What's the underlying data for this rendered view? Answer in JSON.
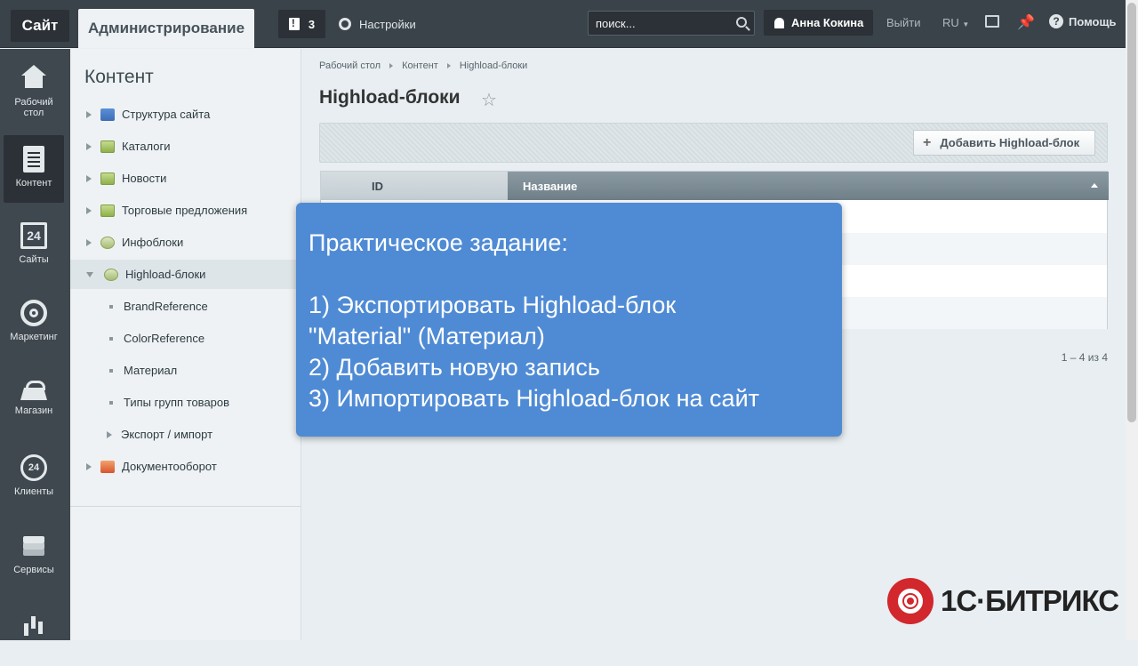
{
  "topbar": {
    "site_label": "Сайт",
    "admin_label": "Администрирование",
    "notifications_count": "3",
    "settings_label": "Настройки",
    "search_placeholder": "поиск...",
    "user_name": "Анна Кокина",
    "logout_label": "Выйти",
    "language_label": "RU",
    "help_label": "Помощь"
  },
  "leftnav": {
    "items": [
      {
        "label": "Рабочий стол",
        "icon": "home-icon"
      },
      {
        "label": "Контент",
        "icon": "document-icon"
      },
      {
        "label": "Сайты",
        "icon": "calendar-24-icon",
        "icon_text": "24"
      },
      {
        "label": "Маркетинг",
        "icon": "target-icon"
      },
      {
        "label": "Магазин",
        "icon": "basket-icon"
      },
      {
        "label": "Клиенты",
        "icon": "clients-24-icon",
        "icon_text": "24"
      },
      {
        "label": "Сервисы",
        "icon": "layers-icon"
      },
      {
        "label": "",
        "icon": "bar-chart-icon"
      }
    ],
    "active_index": 1
  },
  "sidebar": {
    "title": "Контент",
    "items": [
      {
        "label": "Структура сайта"
      },
      {
        "label": "Каталоги"
      },
      {
        "label": "Новости"
      },
      {
        "label": "Торговые предложения"
      },
      {
        "label": "Инфоблоки"
      },
      {
        "label": "Highload-блоки"
      },
      {
        "label": "Документооборот"
      }
    ],
    "subitems": [
      {
        "label": "BrandReference"
      },
      {
        "label": "ColorReference"
      },
      {
        "label": "Материал"
      },
      {
        "label": "Типы групп товаров"
      },
      {
        "label": "Экспорт / импорт"
      }
    ]
  },
  "main": {
    "breadcrumb": [
      "Рабочий стол",
      "Контент",
      "Highload-блоки"
    ],
    "title": "Highload-блоки",
    "add_button_label": "Добавить Highload-блок",
    "table": {
      "columns": [
        "ID",
        "Название"
      ]
    },
    "pager": "1 – 4 из 4"
  },
  "overlay": {
    "title": "Практическое задание:",
    "lines": [
      "1) Экспортировать Highload-блок",
      "\"Material\" (Материал)",
      "2) Добавить новую запись",
      "3) Импортировать Highload-блок на сайт"
    ]
  },
  "logo": {
    "text": "1С·БИТРИКС"
  },
  "colors": {
    "topbar_bg": "#3a4349",
    "overlay_bg": "#4f8bd5",
    "logo_red": "#d1272d"
  }
}
